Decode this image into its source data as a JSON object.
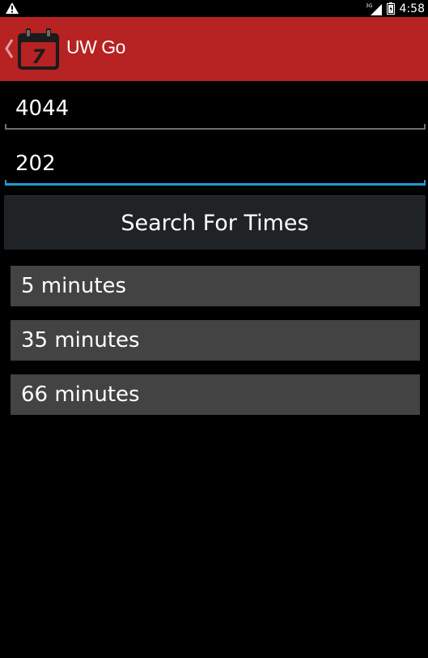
{
  "status_bar": {
    "time": "4:58",
    "network_label": "3G",
    "icons": [
      "warning-icon",
      "signal-icon",
      "battery-icon"
    ]
  },
  "action_bar": {
    "title": "UW Go",
    "app_icon": "calendar-icon",
    "app_icon_day": "7",
    "background_color": "#b72222"
  },
  "inputs": {
    "first_value": "4044",
    "second_value": "202",
    "focus_color": "#1e9ad3"
  },
  "search_button_label": "Search For Times",
  "results": [
    "5 minutes",
    "35 minutes",
    "66 minutes"
  ]
}
